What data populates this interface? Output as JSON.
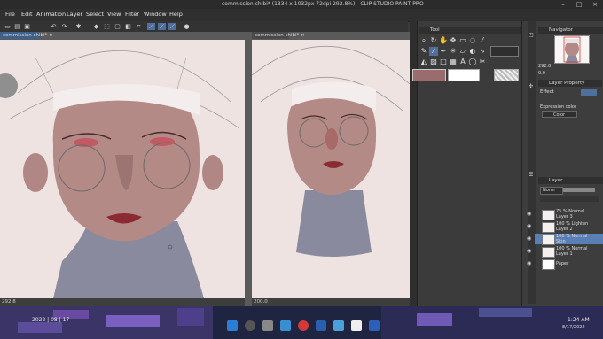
{
  "window": {
    "title": "commission chibi* (1334 x 1032px 72dpi 292.8%) - CLIP STUDIO PAINT PRO"
  },
  "menu": {
    "items": [
      "File",
      "Edit",
      "Animation",
      "Layer",
      "Select",
      "View",
      "Filter",
      "Window",
      "Help"
    ]
  },
  "documents": {
    "tab_left": "commission chibi*",
    "tab_right": "commission chibi*",
    "zoom_left": "292.8",
    "zoom_right": "200.0"
  },
  "tool_panel": {
    "header": "Tool"
  },
  "navigator": {
    "header": "Navigator",
    "zoom": "292.8",
    "angle": "0.0"
  },
  "layer_property": {
    "header": "Layer Property",
    "effect_label": "Effect",
    "expression_color_label": "Expression color",
    "color_value": "Color"
  },
  "layer_panel": {
    "header": "Layer",
    "blend_mode": "Norm",
    "layers": [
      {
        "opacity_mode": "75 % Normal",
        "name": "Layer 3"
      },
      {
        "opacity_mode": "100 % Lighten",
        "name": "Layer 2"
      },
      {
        "opacity_mode": "100 % Normal",
        "name": "Skin"
      },
      {
        "opacity_mode": "100 % Normal",
        "name": "Layer 1"
      },
      {
        "opacity_mode": "",
        "name": "Paper"
      }
    ]
  },
  "taskbar": {
    "date_partial": "2022 | 08 | 17",
    "clock_time": "1:24 AM",
    "clock_date": "8/17/2022"
  },
  "colors": {
    "accent": "#5a7fb5",
    "skin_base": "#b38a86",
    "neck_shadow": "#8a8a9e",
    "paper": "#efe3e1"
  }
}
